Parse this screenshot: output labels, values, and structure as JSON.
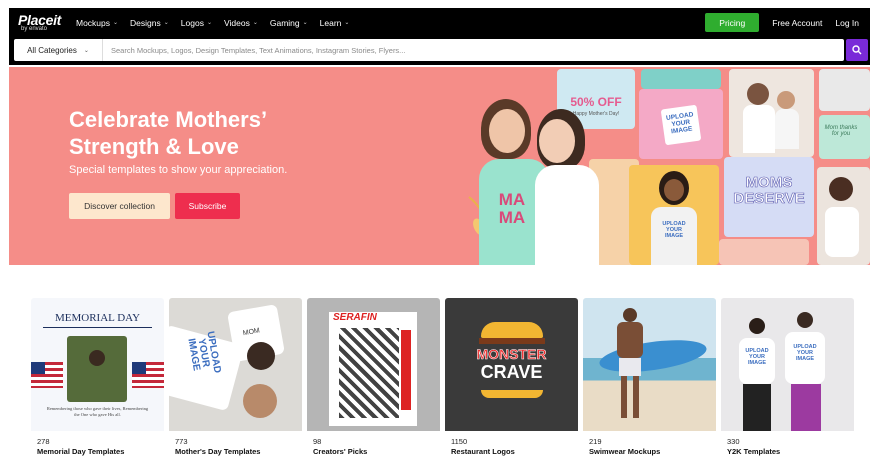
{
  "nav": {
    "logo_text": "Placeit",
    "logo_sub": "by envato",
    "menu": [
      {
        "label": "Mockups"
      },
      {
        "label": "Designs"
      },
      {
        "label": "Logos"
      },
      {
        "label": "Videos"
      },
      {
        "label": "Gaming"
      },
      {
        "label": "Learn"
      }
    ],
    "pricing_label": "Pricing",
    "free_account_label": "Free Account",
    "login_label": "Log In"
  },
  "search": {
    "category_label": "All Categories",
    "placeholder": "Search Mockups, Logos, Design Templates, Text Animations, Instagram Stories, Flyers..."
  },
  "hero": {
    "title_line1": "Celebrate Mothers’",
    "title_line2": "Strength & Love",
    "subtitle": "Special templates to show your appreciation.",
    "discover_label": "Discover collection",
    "subscribe_label": "Subscribe",
    "collage": {
      "percent_text": "50% OFF",
      "happy_text": "Happy Mother's Day!",
      "upload_text_1": "UPLOAD",
      "upload_text_2": "YOUR",
      "upload_text_3": "IMAGE",
      "moms_text_1": "MOMS",
      "moms_text_2": "DESERVE",
      "mama_text_1": "MA",
      "mama_text_2": "MA",
      "mom_thanks": "Mom thanks for you",
      "colors": {
        "hero_bg": "#f58d88",
        "subscribe": "#ee2e4e",
        "discover": "#fde7cd"
      }
    }
  },
  "cards": [
    {
      "count": "278",
      "title": "Memorial Day Templates",
      "art_text": "MEMORIAL DAY",
      "art_caption": "Remembering those who gave their lives, Remembering the One who gave His all."
    },
    {
      "count": "773",
      "title": "Mother's Day Templates",
      "art_text": "UPLOAD YOUR IMAGE",
      "art_caption": "MOM"
    },
    {
      "count": "98",
      "title": "Creators' Picks",
      "art_text": "SERAFIN",
      "art_caption": ""
    },
    {
      "count": "1150",
      "title": "Restaurant Logos",
      "art_text": "MONSTER",
      "art_caption": "CRAVE"
    },
    {
      "count": "219",
      "title": "Swimwear Mockups",
      "art_text": "",
      "art_caption": ""
    },
    {
      "count": "330",
      "title": "Y2K Templates",
      "art_text": "UPLOAD YOUR IMAGE",
      "art_caption": ""
    }
  ]
}
